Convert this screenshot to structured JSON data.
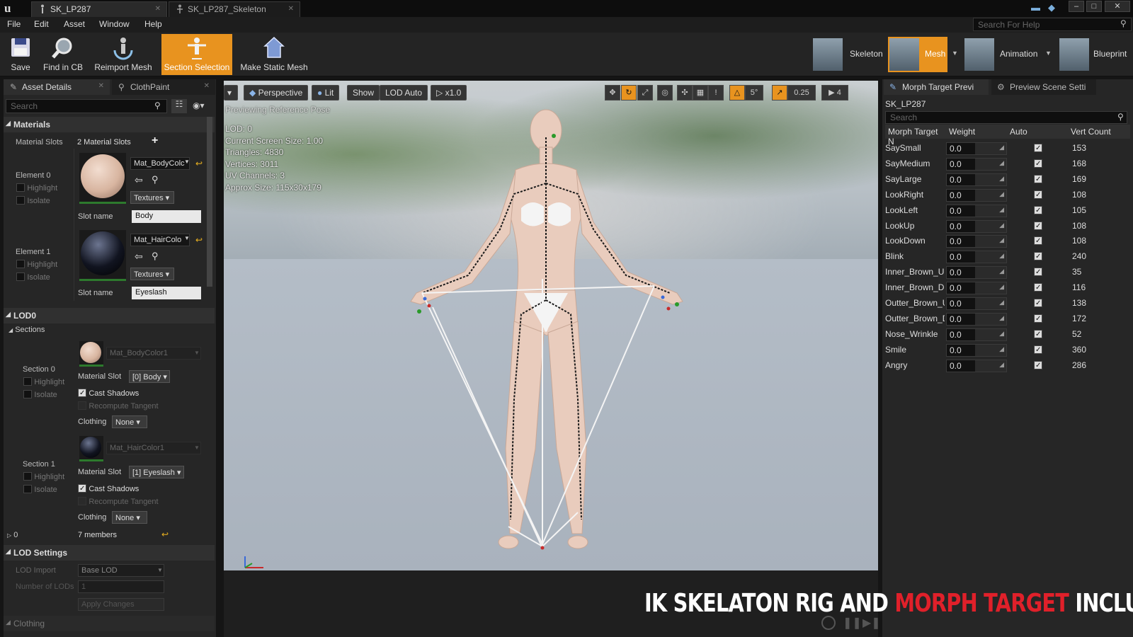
{
  "tabs": [
    {
      "label": "SK_LP287"
    },
    {
      "label": "SK_LP287_Skeleton"
    }
  ],
  "menu": [
    "File",
    "Edit",
    "Asset",
    "Window",
    "Help"
  ],
  "help_search": {
    "placeholder": "Search For Help"
  },
  "toolbar": {
    "save": "Save",
    "find": "Find in CB",
    "reimport": "Reimport Mesh",
    "section": "Section Selection",
    "make_static": "Make Static Mesh"
  },
  "modes": {
    "skeleton": "Skeleton",
    "mesh": "Mesh",
    "animation": "Animation",
    "blueprint": "Blueprint"
  },
  "left": {
    "tab1": "Asset Details",
    "tab2": "ClothPaint",
    "search_placeholder": "Search",
    "materials": {
      "title": "Materials",
      "slots_label": "Material Slots",
      "slots_value": "2 Material Slots",
      "elements": [
        {
          "title": "Element 0",
          "highlight": "Highlight",
          "isolate": "Isolate",
          "material": "Mat_BodyColc",
          "textures": "Textures",
          "slot_label": "Slot name",
          "slot_name": "Body"
        },
        {
          "title": "Element 1",
          "highlight": "Highlight",
          "isolate": "Isolate",
          "material": "Mat_HairColo",
          "textures": "Textures",
          "slot_label": "Slot name",
          "slot_name": "Eyeslash"
        }
      ]
    },
    "lod0": {
      "title": "LOD0",
      "sections_title": "Sections",
      "sections": [
        {
          "title": "Section 0",
          "highlight": "Highlight",
          "isolate": "Isolate",
          "material": "Mat_BodyColor1",
          "slot_label": "Material Slot",
          "slot": "[0] Body",
          "cast": "Cast Shadows",
          "recompute": "Recompute Tangent",
          "clothing_label": "Clothing",
          "clothing": "None"
        },
        {
          "title": "Section 1",
          "highlight": "Highlight",
          "isolate": "Isolate",
          "material": "Mat_HairColor1",
          "slot_label": "Material Slot",
          "slot": "[1] Eyeslash",
          "cast": "Cast Shadows",
          "recompute": "Recompute Tangent",
          "clothing_label": "Clothing",
          "clothing": "None"
        }
      ],
      "index": "0",
      "members": "7 members"
    },
    "lod_settings": {
      "title": "LOD Settings",
      "import_label": "LOD Import",
      "import_value": "Base LOD",
      "num_label": "Number of LODs",
      "num_value": "1",
      "apply": "Apply Changes"
    },
    "clothing": "Clothing"
  },
  "viewport": {
    "perspective": "Perspective",
    "lit": "Lit",
    "show": "Show",
    "lod": "LOD Auto",
    "speed": "x1.0",
    "snap_angle": "5°",
    "scale_snap": "0.25",
    "cam_speed": "4",
    "preview_note": "Previewing Reference Pose",
    "stats": [
      "LOD: 0",
      "Current Screen Size: 1.00",
      "Triangles: 4830",
      "Vertices: 3011",
      "UV Channels: 3",
      "Approx Size: 115x30x179"
    ]
  },
  "right": {
    "tab1": "Morph Target Previ",
    "tab2": "Preview Scene Setti",
    "asset": "SK_LP287",
    "search_placeholder": "Search",
    "headers": {
      "name": "Morph Target N",
      "weight": "Weight",
      "auto": "Auto",
      "count": "Vert Count"
    },
    "rows": [
      {
        "name": "SaySmall",
        "weight": "0.0",
        "count": "153"
      },
      {
        "name": "SayMedium",
        "weight": "0.0",
        "count": "168"
      },
      {
        "name": "SayLarge",
        "weight": "0.0",
        "count": "169"
      },
      {
        "name": "LookRight",
        "weight": "0.0",
        "count": "108"
      },
      {
        "name": "LookLeft",
        "weight": "0.0",
        "count": "105"
      },
      {
        "name": "LookUp",
        "weight": "0.0",
        "count": "108"
      },
      {
        "name": "LookDown",
        "weight": "0.0",
        "count": "108"
      },
      {
        "name": "Blink",
        "weight": "0.0",
        "count": "240"
      },
      {
        "name": "Inner_Brown_Up",
        "weight": "0.0",
        "count": "35"
      },
      {
        "name": "Inner_Brown_Dn",
        "weight": "0.0",
        "count": "116"
      },
      {
        "name": "Outter_Brown_Up",
        "weight": "0.0",
        "count": "138"
      },
      {
        "name": "Outter_Brown_Dn",
        "weight": "0.0",
        "count": "172"
      },
      {
        "name": "Nose_Wrinkle",
        "weight": "0.0",
        "count": "52"
      },
      {
        "name": "Smile",
        "weight": "0.0",
        "count": "360"
      },
      {
        "name": "Angry",
        "weight": "0.0",
        "count": "286"
      }
    ]
  },
  "banner": {
    "part1": "IK SKELATON RIG AND ",
    "part2": "MORPH TARGET",
    "part3": " INCLUDE"
  }
}
